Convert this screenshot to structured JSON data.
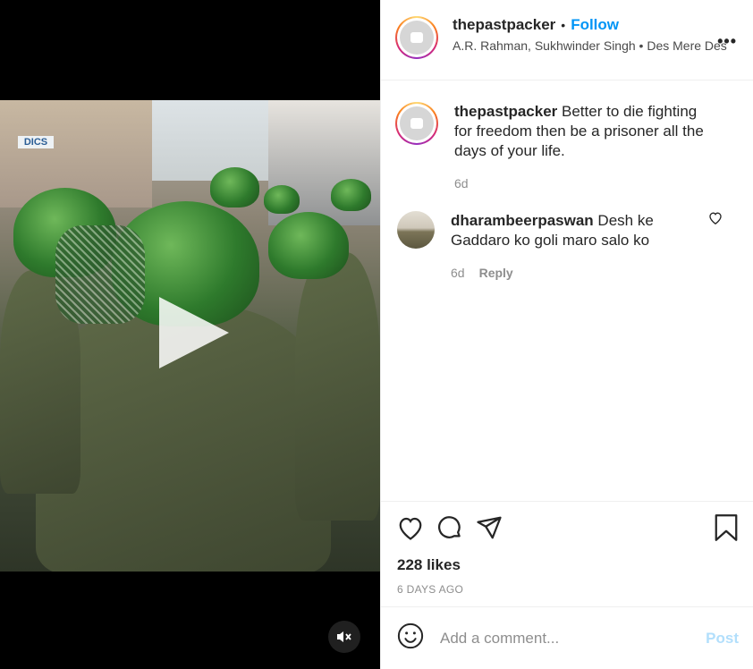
{
  "author": {
    "username": "thepastpacker",
    "follow_label": "Follow",
    "separator": "•",
    "music": "A.R. Rahman, Sukhwinder Singh • Des Mere Des"
  },
  "media": {
    "sign_text": "DICS"
  },
  "comments": [
    {
      "username": "thepastpacker",
      "text": "Better to die fighting for freedom then be a prisoner all the days of your life.",
      "age": "6d"
    },
    {
      "username": "dharambeerpaswan",
      "text": "Desh ke Gaddaro ko goli maro salo ko",
      "age": "6d",
      "reply_label": "Reply"
    }
  ],
  "post": {
    "likes": "228 likes",
    "time": "6 DAYS AGO"
  },
  "add_comment": {
    "placeholder": "Add a comment...",
    "post_label": "Post"
  },
  "icons": {
    "more": "more-options-icon",
    "play": "play-icon",
    "mute": "muted-speaker-icon",
    "like": "heart-icon",
    "comment": "comment-bubble-icon",
    "share": "paper-plane-icon",
    "save": "bookmark-icon",
    "emoji": "emoji-icon"
  },
  "colors": {
    "follow": "#0095f6",
    "post_button_disabled": "#b2dffc",
    "muted_text": "#8e8e8e"
  }
}
